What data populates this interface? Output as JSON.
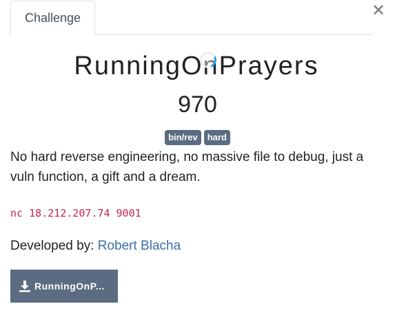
{
  "tabs": {
    "challenge_label": "Challenge"
  },
  "close_icon": "close-icon",
  "challenge": {
    "name": "RunningOnPrayers",
    "points": "970",
    "tags": [
      "bin/rev",
      "hard"
    ],
    "description": "No hard reverse engineering, no massive file to debug, just a vuln function, a gift and a dream.",
    "connection": "nc 18.212.207.74 9001",
    "developer_prefix": "Developed by:",
    "developer_name": "Robert Blacha",
    "download_label": "RunningOnP..."
  },
  "colors": {
    "tag_bg": "#5a6b82",
    "code_text": "#c7254e",
    "link": "#3a6fa8",
    "spinner_accent": "#2d9ee0"
  },
  "icons": {
    "download": "download-icon",
    "loading": "loading-spinner-icon"
  }
}
